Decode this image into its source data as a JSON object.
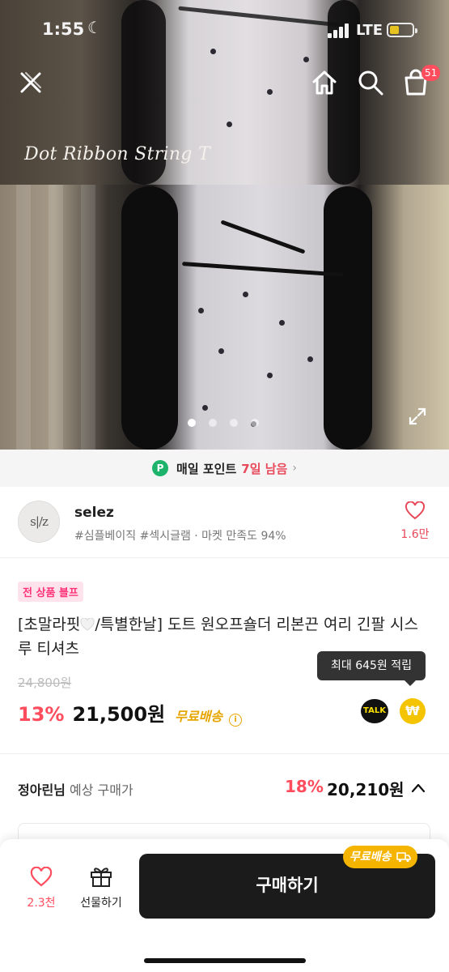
{
  "status_bar": {
    "time": "1:55",
    "network": "LTE"
  },
  "nav": {
    "cart_count": "51"
  },
  "hero": {
    "caption": "Dot Ribbon String T"
  },
  "points_banner": {
    "prefix": "P",
    "text": "매일 포인트",
    "days_left": "7일 남음"
  },
  "seller": {
    "avatar_text": "s|/z",
    "name": "selez",
    "tags": "#심플베이직 #섹시글램 · 마켓 만족도 94%",
    "likes": "1.6만"
  },
  "product": {
    "sale_tag": "전 상품 블프",
    "title_part1": "[초말라핏",
    "title_part2": "/특별한날] 도트 원오프숄더 리본끈 여리 긴팔 시스루 티셔츠",
    "original_price": "24,800원",
    "discount": "13%",
    "price": "21,500원",
    "shipping": "무료배송",
    "tooltip": "최대 645원 적립",
    "talk_label": "TALK",
    "pay_symbol": "₩"
  },
  "expected_price": {
    "user_name": "정아린님",
    "label": "예상 구매가",
    "discount": "18%",
    "amount": "20,210원"
  },
  "bottom_bar": {
    "likes": "2.3천",
    "gift_label": "선물하기",
    "buy_label": "구매하기",
    "buy_badge": "무료배송"
  },
  "colors": {
    "accent_red": "#ff4d5e",
    "shipping_yellow": "#e7a500",
    "point_green": "#1db36b",
    "buy_button": "#1b1b1b"
  }
}
